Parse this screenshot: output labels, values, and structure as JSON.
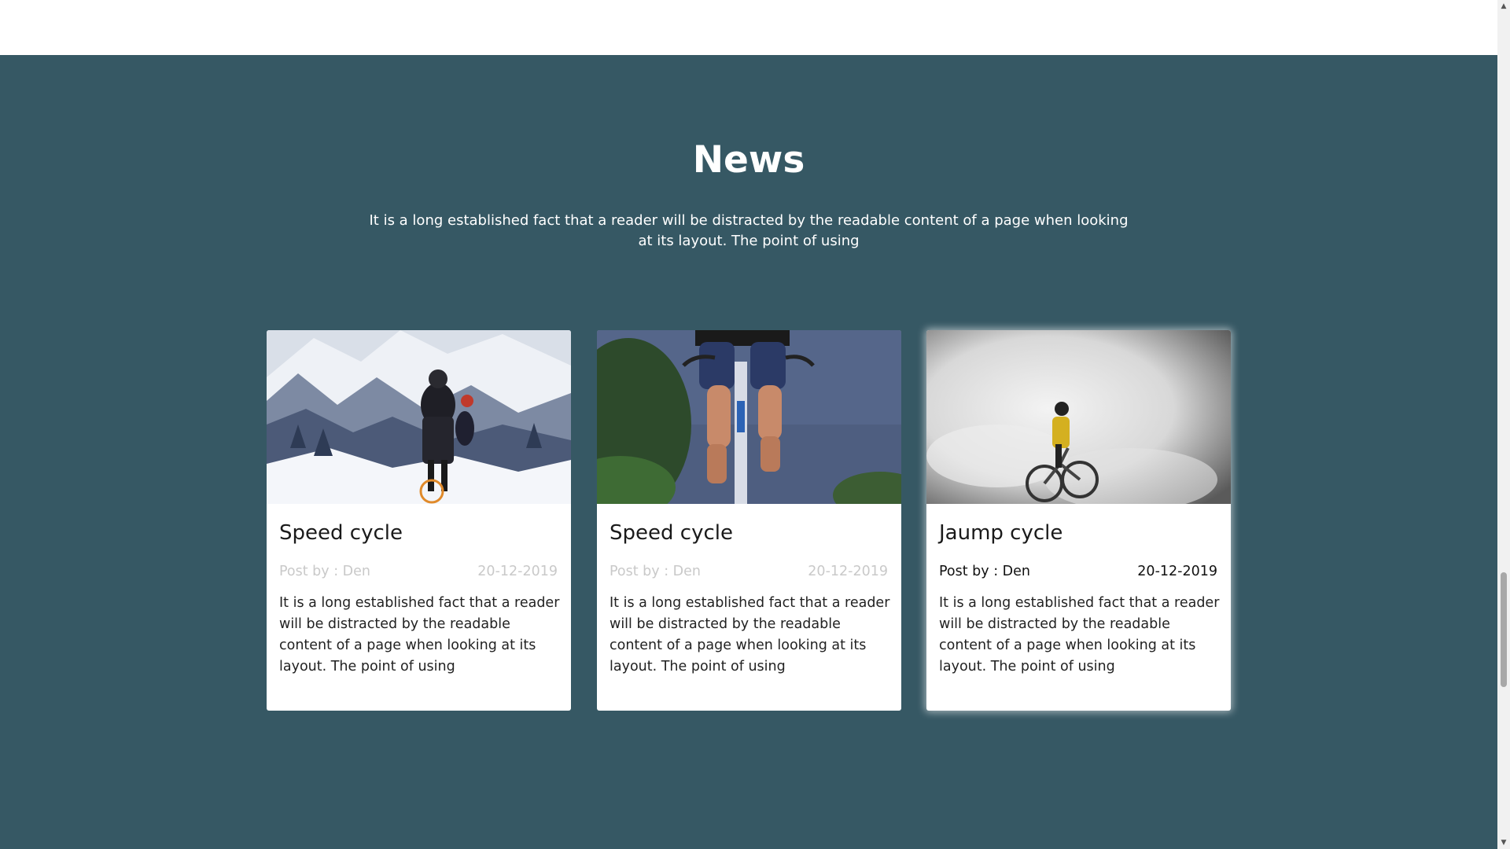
{
  "news": {
    "title": "News",
    "subtitle": "It is a long established fact that a reader will be distracted by the readable content of a page when looking at its layout. The point of using"
  },
  "cards": [
    {
      "image": "snow-mountain-cyclists",
      "title": "Speed cycle",
      "author": "Post by : Den",
      "date": "20-12-2019",
      "text": "It is a long established fact that a reader will be distracted by the readable content of a page when looking at its layout. The point of using"
    },
    {
      "image": "road-cyclist-legs",
      "title": "Speed cycle",
      "author": "Post by : Den",
      "date": "20-12-2019",
      "text": "It is a long established fact that a reader will be distracted by the readable content of a page when looking at its layout. The point of using"
    },
    {
      "image": "jump-cyclist-clouds",
      "title": "Jaump cycle",
      "author": "Post by : Den",
      "date": "20-12-2019",
      "text": "It is a long established fact that a reader will be distracted by the readable content of a page when looking at its layout. The point of using"
    }
  ],
  "colors": {
    "section_bg": "#365864",
    "card_bg": "#ffffff",
    "muted_meta": "#c9c9c9"
  }
}
